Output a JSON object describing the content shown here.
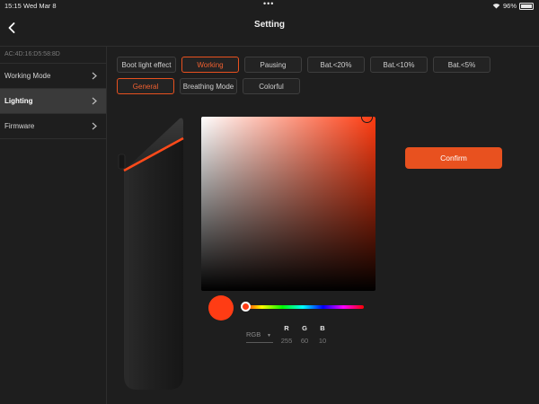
{
  "status_bar": {
    "time": "15:15",
    "date": "Wed Mar 8",
    "battery": "96%",
    "battery_level": 0.96
  },
  "nav": {
    "title": "Setting"
  },
  "sidebar": {
    "device_id": "AC:4D:16:D5:58:8D",
    "items": [
      {
        "label": "Working Mode",
        "active": false
      },
      {
        "label": "Lighting",
        "active": true
      },
      {
        "label": "Firmware",
        "active": false
      }
    ]
  },
  "tabs_row1": [
    {
      "label": "Boot light effect",
      "selected": false
    },
    {
      "label": "Working",
      "selected": true
    },
    {
      "label": "Pausing",
      "selected": false
    },
    {
      "label": "Bat.<20%",
      "selected": false
    },
    {
      "label": "Bat.<10%",
      "selected": false
    },
    {
      "label": "Bat.<5%",
      "selected": false
    }
  ],
  "tabs_row2": [
    {
      "label": "General",
      "selected": true
    },
    {
      "label": "Breathing Mode",
      "selected": false
    },
    {
      "label": "Colorful",
      "selected": false
    }
  ],
  "picker": {
    "confirm_label": "Confirm",
    "mode": "RGB",
    "channels": [
      {
        "label": "R",
        "value": "255"
      },
      {
        "label": "G",
        "value": "60"
      },
      {
        "label": "B",
        "value": "10"
      }
    ],
    "selected_color": "#ff3c14"
  },
  "colors": {
    "accent": "#e8511f",
    "background": "#1e1e1e"
  }
}
